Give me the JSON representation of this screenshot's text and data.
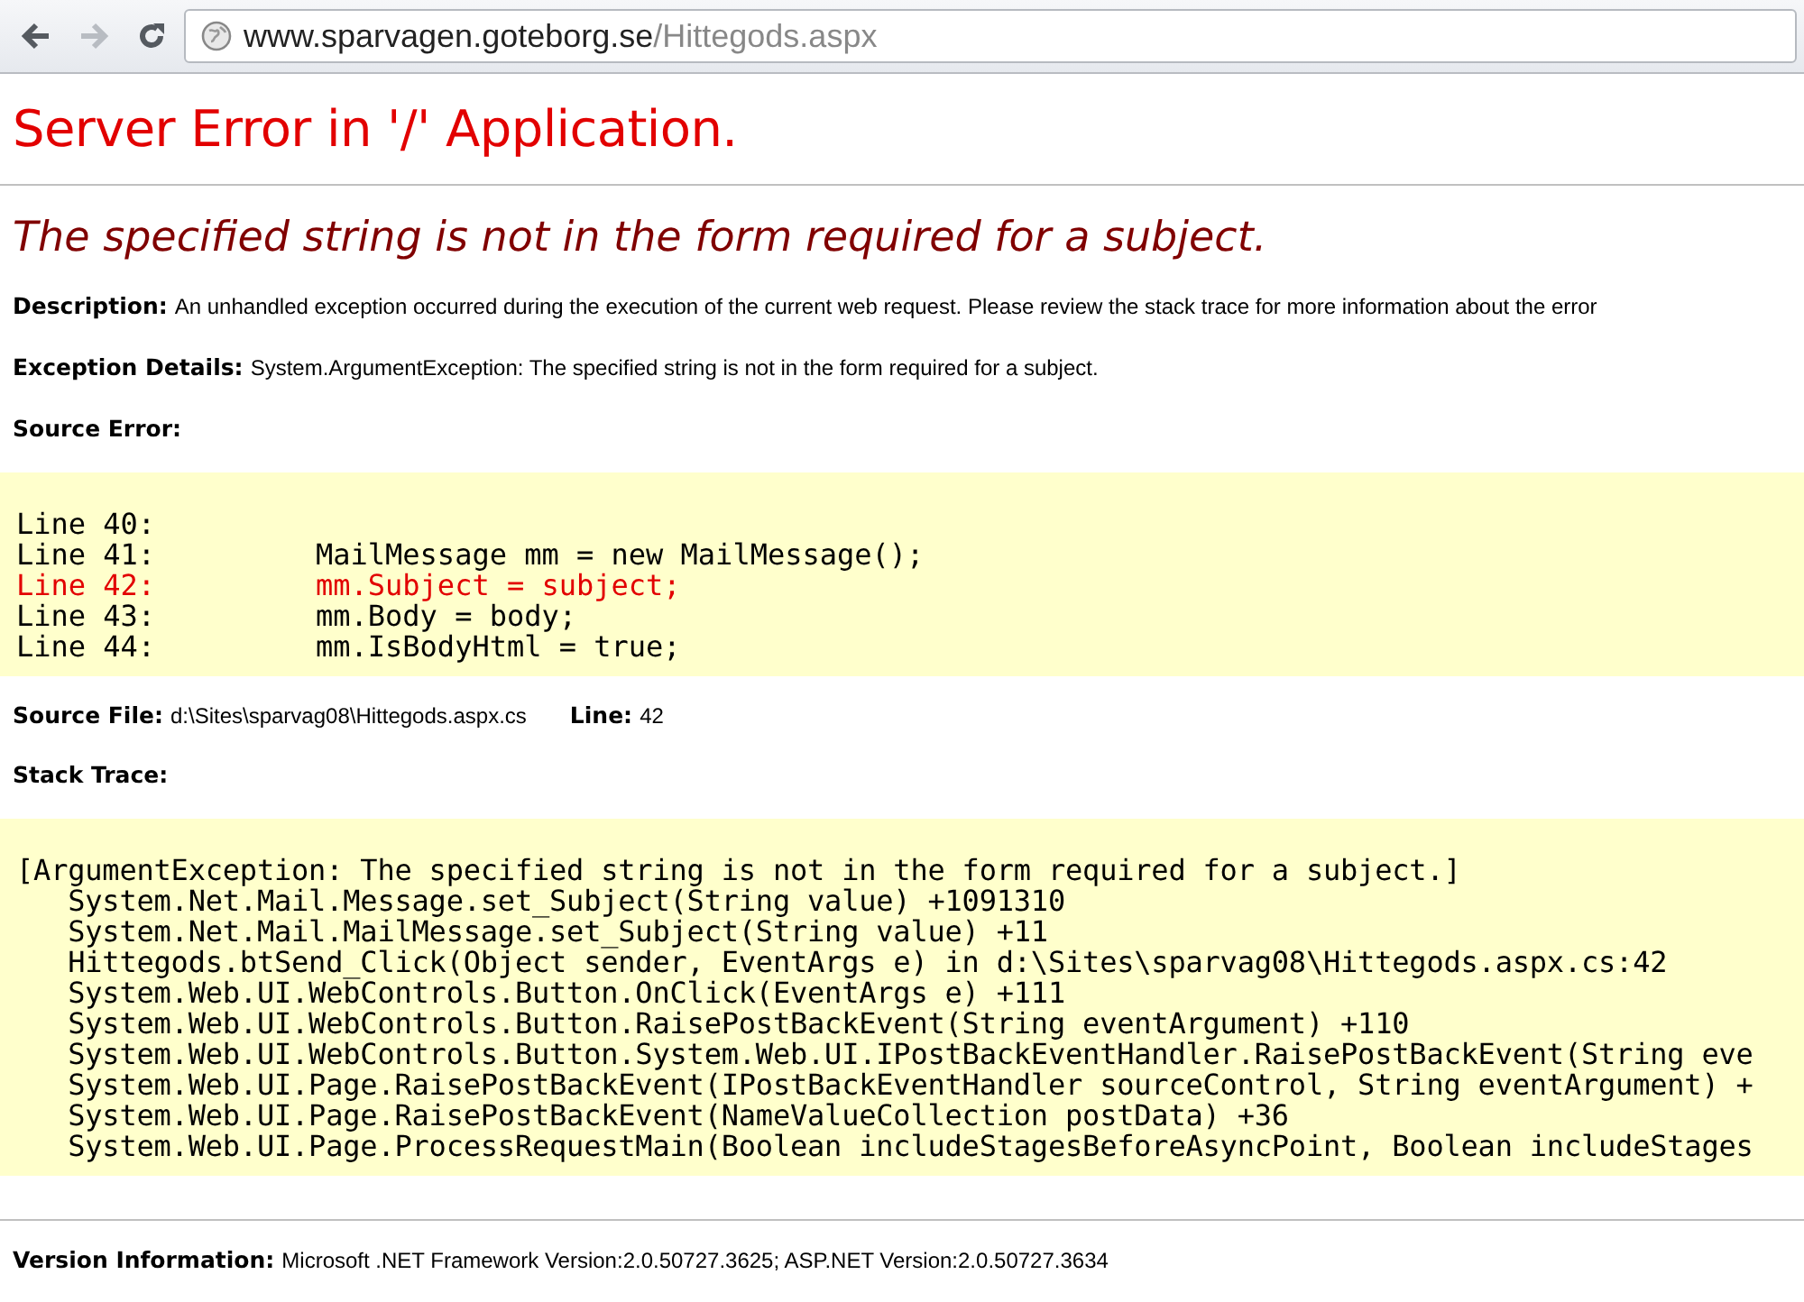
{
  "browser": {
    "back_disabled": false,
    "forward_disabled": true,
    "url_host": "www.sparvagen.goteborg.se",
    "url_path": "/Hittegods.aspx"
  },
  "title": "Server Error in '/' Application.",
  "subtitle": "The specified string is not in the form required for a subject.",
  "description": {
    "label": "Description:",
    "text": "An unhandled exception occurred during the execution of the current web request. Please review the stack trace for more information about the error"
  },
  "exception_details": {
    "label": "Exception Details:",
    "text": "System.ArgumentException: The specified string is not in the form required for a subject."
  },
  "source_error": {
    "label": "Source Error:",
    "lines": [
      {
        "number": "Line 40:",
        "highlighted": false
      },
      {
        "number": "Line 41:",
        "code": "MailMessage mm = new MailMessage();",
        "highlighted": false
      },
      {
        "number": "Line 42:",
        "code": "mm.Subject = subject;",
        "highlighted": true
      },
      {
        "number": "Line 43:",
        "code": "mm.Body = body;",
        "highlighted": false
      },
      {
        "number": "Line 44:",
        "code": "mm.IsBodyHtml = true;",
        "highlighted": false
      }
    ]
  },
  "source_file": {
    "label": "Source File:",
    "text": "d:\\Sites\\sparvag08\\Hittegods.aspx.cs",
    "line_label": "Line:",
    "line": "42"
  },
  "stack_trace": {
    "label": "Stack Trace:",
    "lines": [
      "[ArgumentException: The specified string is not in the form required for a subject.]",
      "   System.Net.Mail.Message.set_Subject(String value) +1091310",
      "   System.Net.Mail.MailMessage.set_Subject(String value) +11",
      "   Hittegods.btSend_Click(Object sender, EventArgs e) in d:\\Sites\\sparvag08\\Hittegods.aspx.cs:42",
      "   System.Web.UI.WebControls.Button.OnClick(EventArgs e) +111",
      "   System.Web.UI.WebControls.Button.RaisePostBackEvent(String eventArgument) +110",
      "   System.Web.UI.WebControls.Button.System.Web.UI.IPostBackEventHandler.RaisePostBackEvent(String eve",
      "   System.Web.UI.Page.RaisePostBackEvent(IPostBackEventHandler sourceControl, String eventArgument) +",
      "   System.Web.UI.Page.RaisePostBackEvent(NameValueCollection postData) +36",
      "   System.Web.UI.Page.ProcessRequestMain(Boolean includeStagesBeforeAsyncPoint, Boolean includeStages"
    ]
  },
  "version": {
    "label": "Version Information:",
    "text": "Microsoft .NET Framework Version:2.0.50727.3625; ASP.NET Version:2.0.50727.3634"
  }
}
